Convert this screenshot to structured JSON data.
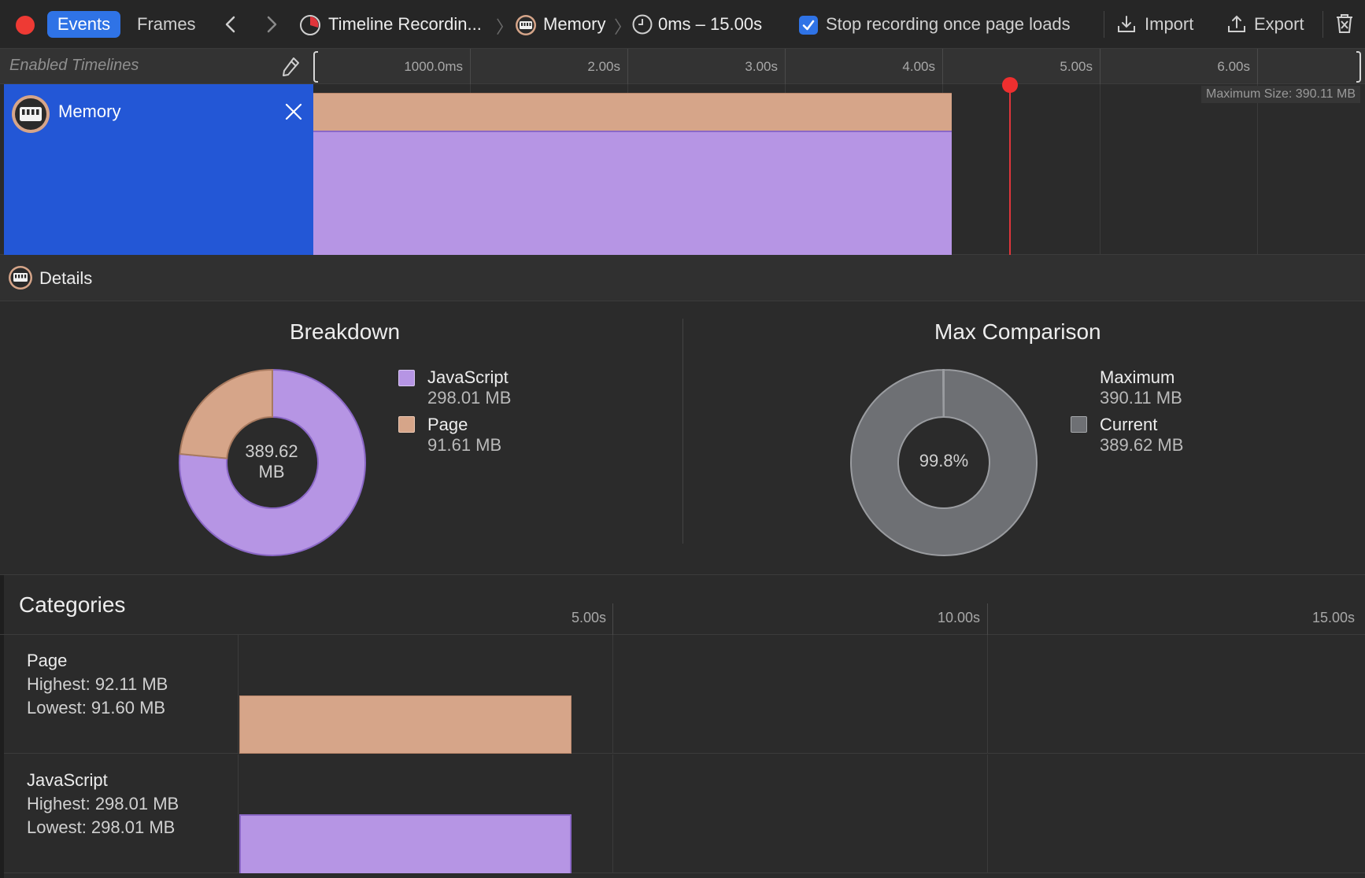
{
  "toolbar": {
    "tab_events": "Events",
    "tab_frames": "Frames",
    "breadcrumb_recording": "Timeline Recordin...",
    "breadcrumb_memory": "Memory",
    "breadcrumb_range": "0ms – 15.00s",
    "stop_recording_label": "Stop recording once page loads",
    "stop_recording_checked": true,
    "import_label": "Import",
    "export_label": "Export",
    "accent_color": "#2f73e6",
    "record_color": "#ee3a34"
  },
  "timeline": {
    "enabled_label": "Enabled Timelines",
    "ticks": [
      "1000.0ms",
      "2.00s",
      "3.00s",
      "4.00s",
      "5.00s",
      "6.00s"
    ],
    "track_name": "Memory",
    "max_size_label": "Maximum Size: 390.11 MB",
    "recording_end_seconds": 4.06,
    "playhead_seconds": 4.44
  },
  "details": {
    "label": "Details"
  },
  "breakdown": {
    "title": "Breakdown",
    "center_value": "389.62",
    "center_unit": "MB",
    "legend": [
      {
        "name": "JavaScript",
        "value": "298.01 MB",
        "color": "#b695e4"
      },
      {
        "name": "Page",
        "value": "91.61 MB",
        "color": "#d6a589"
      }
    ]
  },
  "max_comparison": {
    "title": "Max Comparison",
    "center_value": "99.8%",
    "legend": [
      {
        "name": "Maximum",
        "value": "390.11 MB"
      },
      {
        "name": "Current",
        "value": "389.62 MB",
        "color": "#6e7074"
      }
    ]
  },
  "categories": {
    "title": "Categories",
    "ticks": [
      "5.00s",
      "10.00s",
      "15.00s"
    ],
    "rows": [
      {
        "name": "Page",
        "highest": "Highest: 92.11 MB",
        "lowest": "Lowest: 91.60 MB",
        "color": "#d6a589"
      },
      {
        "name": "JavaScript",
        "highest": "Highest: 298.01 MB",
        "lowest": "Lowest: 298.01 MB",
        "color": "#b695e4"
      }
    ]
  },
  "chart_data": [
    {
      "type": "pie",
      "title": "Breakdown",
      "categories": [
        "JavaScript",
        "Page"
      ],
      "values": [
        298.01,
        91.61
      ]
    },
    {
      "type": "pie",
      "title": "Max Comparison",
      "categories": [
        "Current",
        "Maximum"
      ],
      "values": [
        389.62,
        390.11
      ]
    }
  ]
}
